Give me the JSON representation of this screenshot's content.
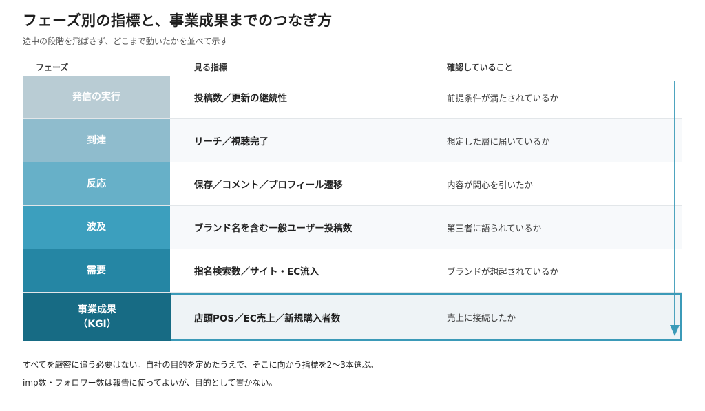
{
  "title": "フェーズ別の指標と、事業成果までのつなぎ方",
  "subtitle": "途中の段階を飛ばさず、どこまで動いたかを並べて示す",
  "headers": {
    "phase": "フェーズ",
    "metric": "見る指標",
    "check": "確認していること"
  },
  "rows": [
    {
      "phase": "発信の実行",
      "metric": "投稿数／更新の継続性",
      "check": "前提条件が満たされているか",
      "color": "#b9ccd4"
    },
    {
      "phase": "到達",
      "metric": "リーチ／視聴完了",
      "check": "想定した層に届いているか",
      "color": "#8fbccd"
    },
    {
      "phase": "反応",
      "metric": "保存／コメント／プロフィール遷移",
      "check": "内容が関心を引いたか",
      "color": "#67b0c8"
    },
    {
      "phase": "波及",
      "metric": "ブランド名を含む一般ユーザー投稿数",
      "check": "第三者に語られているか",
      "color": "#3c9fbe"
    },
    {
      "phase": "需要",
      "metric": "指名検索数／サイト・EC流入",
      "check": "ブランドが想起されているか",
      "color": "#2586a4"
    },
    {
      "phase": "事業成果\n（KGI）",
      "metric": "店頭POS／EC売上／新規購入者数",
      "check": "売上に接続したか",
      "color": "#176b84"
    }
  ],
  "notes": [
    "すべてを厳密に追う必要はない。自社の目的を定めたうえで、そこに向かう指標を2〜3本選ぶ。",
    "imp数・フォロワー数は報告に使ってよいが、目的として置かない。"
  ],
  "accent": "#3b9ab8"
}
